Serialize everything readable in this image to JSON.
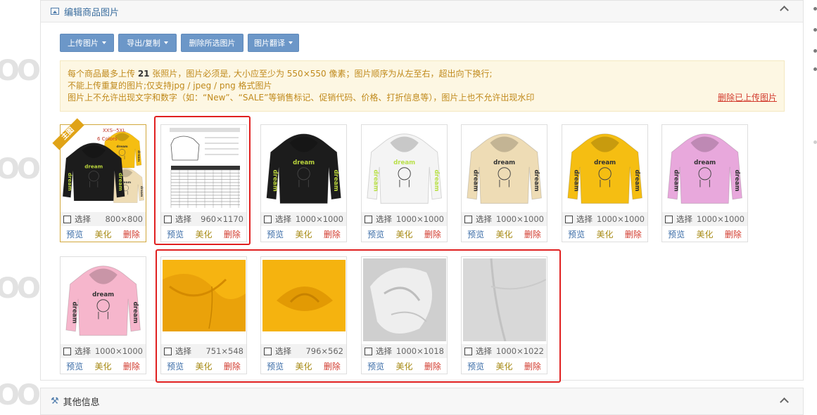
{
  "panel_images": {
    "title": "编辑商品图片",
    "toolbar": [
      {
        "label": "上传图片",
        "dropdown": true
      },
      {
        "label": "导出/复制",
        "dropdown": true
      },
      {
        "label": "删除所选图片",
        "dropdown": false
      },
      {
        "label": "图片翻译",
        "dropdown": true
      }
    ],
    "notice": {
      "line1_prefix": "每个商品最多上传 ",
      "line1_count": "21",
      "line1_suffix": " 张照片，图片必须是, 大小应至少为 550×550 像素；图片顺序为从左至右，超出向下换行;",
      "line2": "不能上传重复的图片;仅支持jpg / jpeg / png 格式图片",
      "line3": "图片上不允许出现文字和数字（如：“New”、“SALE”等销售标记、促销代码、价格、打折信息等），图片上也不允许出现水印",
      "delete_link": "删除已上传图片"
    },
    "card_labels": {
      "select": "选择",
      "preview": "预览",
      "beautify": "美化",
      "delete": "删除"
    },
    "main_badge": "主图",
    "main_overlay_text": "XXS--5XL",
    "main_overlay_colors": "6 Colors",
    "hoodie_print": "dream",
    "images": [
      {
        "dims": "800×800",
        "kind": "collage"
      },
      {
        "dims": "960×1170",
        "kind": "sizechart"
      },
      {
        "dims": "1000×1000",
        "kind": "hoodie",
        "color": "#1c1c1c",
        "accent": "#b9d33c"
      },
      {
        "dims": "1000×1000",
        "kind": "hoodie",
        "color": "#f4f4f4",
        "accent": "#b9e04a"
      },
      {
        "dims": "1000×1000",
        "kind": "hoodie",
        "color": "#eedcb5",
        "accent": "#333333"
      },
      {
        "dims": "1000×1000",
        "kind": "hoodie",
        "color": "#f5be12",
        "accent": "#333333"
      },
      {
        "dims": "1000×1000",
        "kind": "hoodie",
        "color": "#e8a8dc",
        "accent": "#333333"
      },
      {
        "dims": "1000×1000",
        "kind": "hoodie",
        "color": "#f6b6cc",
        "accent": "#333333"
      },
      {
        "dims": "751×548",
        "kind": "fabric-yellow"
      },
      {
        "dims": "796×562",
        "kind": "fabric-yellow2"
      },
      {
        "dims": "1000×1018",
        "kind": "fabric-white"
      },
      {
        "dims": "1000×1022",
        "kind": "fabric-grey"
      }
    ]
  },
  "panel_other": {
    "title": "其他信息"
  }
}
